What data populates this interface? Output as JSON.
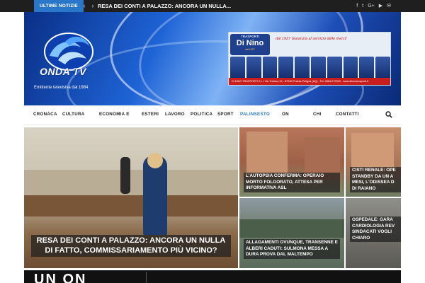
{
  "ticker": {
    "label": "ULTIME NOTIZIE",
    "prev_glyph": "‹",
    "next_glyph": "›",
    "headline": "RESA DEI CONTI A PALAZZO: ANCORA UN NULLA..."
  },
  "social": {
    "facebook": "f",
    "twitter": "t",
    "googleplus": "G+",
    "youtube": "▶",
    "mail": "✉"
  },
  "header": {
    "logo_text": "ONDA TV",
    "tagline": "Emittente televisiva dal 1984",
    "ad": {
      "brand_top": "TRASPORTI",
      "brand": "Di Nino",
      "brand_sub": "dal 1927",
      "slogan": "dal 1927 Garanzia al servizio delle merci!",
      "footer": "DI NINO TRASPORTI S.r.l. Via Tratturo,13 - 67035 Pratola Peligna (AQ) - Tel. 0864.272329 - www.dininotrasporti.it"
    }
  },
  "nav": {
    "items": [
      "CRONACA",
      "CULTURA",
      "ECONOMIA E",
      "ESTERI",
      "LAVORO",
      "POLITICA",
      "SPORT",
      "PALINSESTO",
      "ON",
      "CHI",
      "CONTATTI"
    ],
    "active": "PALINSESTO"
  },
  "featured": {
    "main": {
      "caption": "RESA DEI CONTI A PALAZZO: ANCORA UN NULLA DI FATTO, COMMISSARIAMENTO PIÙ VICINO?"
    },
    "tiles": [
      {
        "caption": "L'AUTOPSIA CONFERMA: OPERAIO MORTO FOLGORATO, ATTESA PER INFORMATIVA ASL"
      },
      {
        "caption": "CISTI RENALE: OPE STANDBY DA UN A MESI, L'ODISSEA D DI RAIANO"
      },
      {
        "caption": "ALLAGAMENTI OVUNQUE, TRANSENNE E ALBERI CADUTI: SULMONA MESSA A DURA PROVA DAL MALTEMPO"
      },
      {
        "caption": "OSPEDALE: GARA CARDIOLOGIA REV SINDACATI VOGLI CHIARO"
      }
    ]
  },
  "bottom": {
    "big_text": "UN ON"
  },
  "colors": {
    "accent": "#2a77c9",
    "topbar": "#1f1f1f",
    "header_blue": "#1e63d6"
  }
}
